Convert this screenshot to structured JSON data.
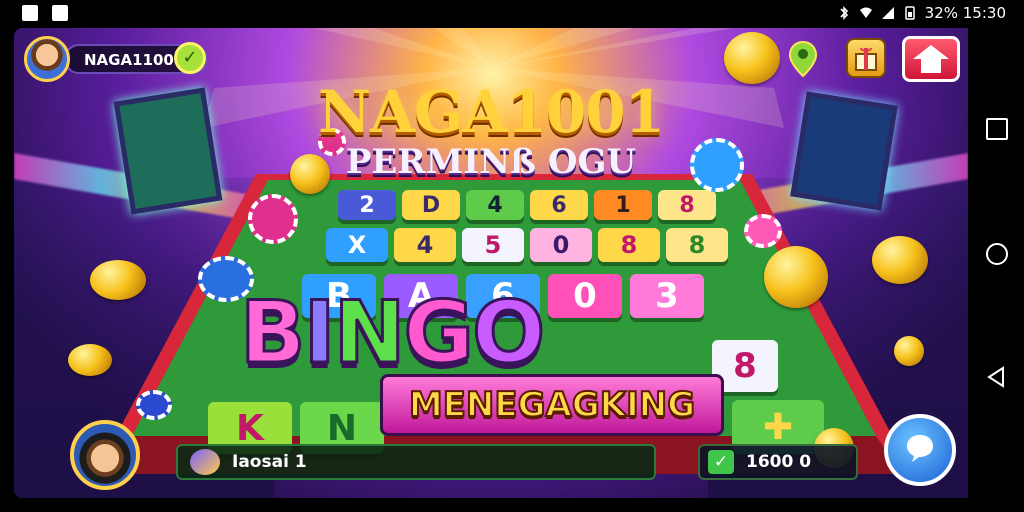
{
  "status_bar": {
    "battery_time": "32% 15:30"
  },
  "hud": {
    "player_name": "NAGA1100",
    "ticket_label": "Iaosai 1",
    "coin_label": "1600 0 "
  },
  "titles": {
    "main": "NAGA1001",
    "sub": "PERMINß OGU",
    "bingo": [
      "B",
      "I",
      "N",
      "G",
      "O"
    ],
    "banner": "MENEGAGKING"
  },
  "board": {
    "row1": [
      "2",
      "D",
      "4",
      "6",
      "1",
      "8"
    ],
    "row2": [
      "X",
      "4",
      "5",
      "0",
      "8",
      "8"
    ],
    "row3": [
      "B",
      "A",
      "6",
      "0",
      "3"
    ],
    "side": "8",
    "bottom_left": [
      "K",
      "N"
    ],
    "bottom_right": [
      "✚"
    ]
  },
  "colors": {
    "accent_gold": "#ffd23c",
    "board_green": "#2f9a3a",
    "board_red": "#d8263a"
  },
  "icons": [
    "avatar-icon",
    "check-icon",
    "location-pin-icon",
    "gift-icon",
    "home-icon",
    "ticket-icon",
    "chat-icon"
  ]
}
